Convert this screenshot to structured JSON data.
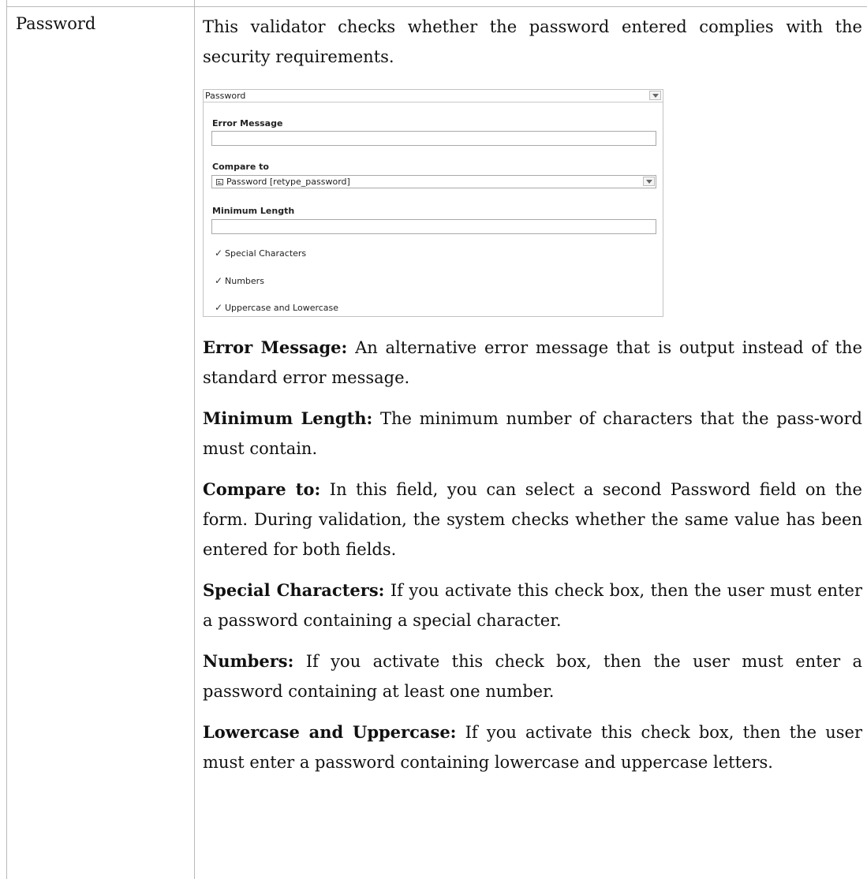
{
  "row_label": "Password",
  "intro": "This validator checks whether the password entered complies with the security requirements.",
  "screenshot": {
    "header_value": "Password",
    "error_message_label": "Error Message",
    "error_message_value": "",
    "compare_to_label": "Compare to",
    "compare_to_value": "Password [retype_password]",
    "min_length_label": "Minimum Length",
    "min_length_value": "",
    "checkboxes": [
      {
        "label": "Special Characters",
        "checked": true
      },
      {
        "label": "Numbers",
        "checked": true
      },
      {
        "label": "Uppercase and Lowercase",
        "checked": true
      }
    ]
  },
  "descriptions": [
    {
      "term": "Error Message:",
      "text": " An alternative error message that is output instead of the standard error message."
    },
    {
      "term": "Minimum Length:",
      "text": "  The minimum number of characters that the pass-word must contain."
    },
    {
      "term": "Compare to:",
      "text": "  In this field, you can select a second Password field on the form. During validation, the system checks whether the same value has been entered for both fields."
    },
    {
      "term": "Special Characters:",
      "text": "  If you activate this check box, then the user must enter a password containing a special character."
    },
    {
      "term": "Numbers:",
      "text": "  If you activate this check box, then the user must enter a password containing at least one number."
    },
    {
      "term": "Lowercase and Uppercase:",
      "text": "  If you activate this check box, then the user must enter a password containing lowercase and uppercase letters."
    }
  ]
}
